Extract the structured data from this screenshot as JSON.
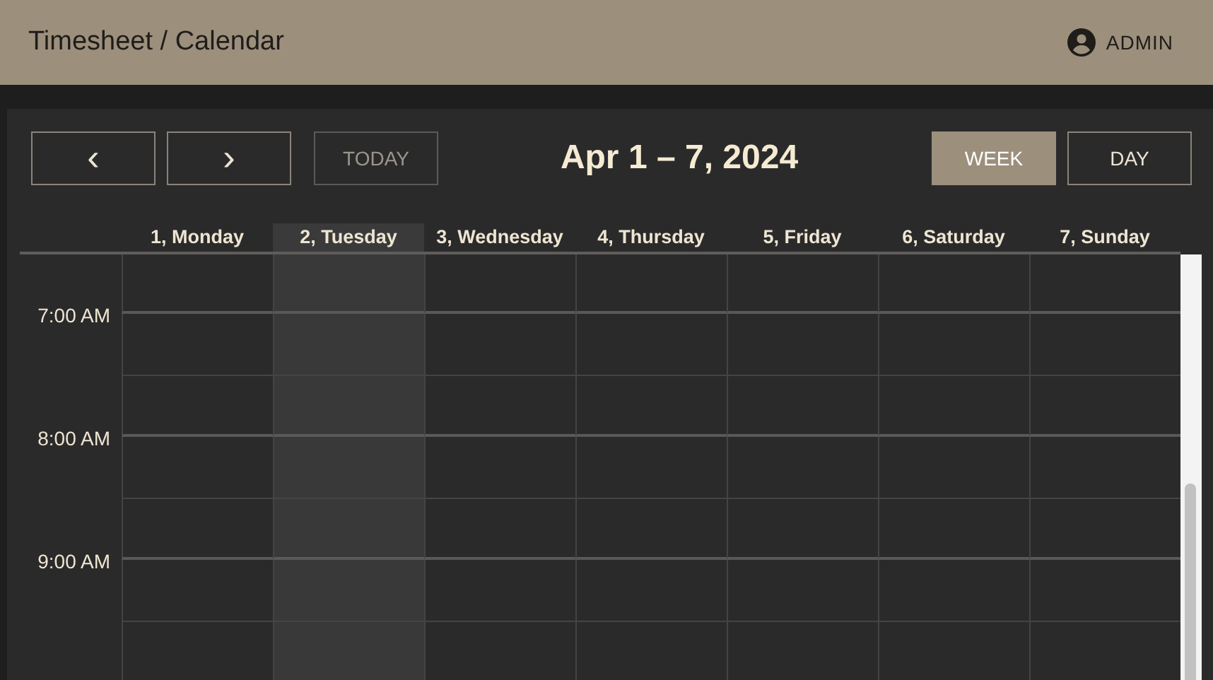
{
  "app_bar": {
    "title": "Timesheet / Calendar",
    "user": "ADMIN"
  },
  "toolbar": {
    "nav": [
      {
        "icon": "‹"
      },
      {
        "icon": "›"
      }
    ],
    "today": {
      "label": "TODAY",
      "disabled": true
    },
    "range": "Apr 1 – 7, 2024",
    "views": [
      {
        "label": "WEEK",
        "selected": true
      },
      {
        "label": "DAY",
        "selected": false
      }
    ]
  },
  "days": [
    {
      "label": "1, Monday",
      "selected": false
    },
    {
      "label": "2, Tuesday",
      "selected": true
    },
    {
      "label": "3, Wednesday",
      "selected": false
    },
    {
      "label": "4, Thursday",
      "selected": false
    },
    {
      "label": "5, Friday",
      "selected": false
    },
    {
      "label": "6, Saturday",
      "selected": false
    },
    {
      "label": "7, Sunday",
      "selected": false
    }
  ],
  "times": [
    "7:00 AM",
    "8:00 AM",
    "9:00 AM"
  ]
}
